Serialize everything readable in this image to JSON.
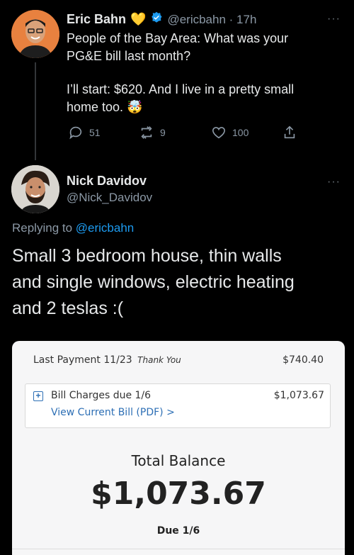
{
  "tweet": {
    "name": "Eric Bahn",
    "emoji_heart": "💛",
    "handle_time": "@ericbahn · 17h",
    "text_line1": "People of the Bay Area: What was your",
    "text_line2": "PG&E bill last month?",
    "text_line3": "I’ll start: $620. And I live in a pretty small",
    "text_line4": "home too.",
    "text_emoji": "🤯",
    "replies": "51",
    "retweets": "9",
    "likes": "100",
    "more": "···"
  },
  "reply": {
    "name": "Nick Davidov",
    "handle": "@Nick_Davidov",
    "replying_prefix": "Replying to ",
    "replying_to": "@ericbahn",
    "line1": "Small 3 bedroom house, thin walls",
    "line2": "and single windows, electric heating",
    "line3": "and 2 teslas :(",
    "more": "···"
  },
  "bill_card": {
    "last_payment_label": "Last Payment 11/23",
    "thank_you": "Thank You",
    "last_payment_amount": "$740.40",
    "plus_symbol": "+",
    "bill_charges_label": "Bill Charges due 1/6",
    "bill_charges_amount": "$1,073.67",
    "view_bill_link": "View Current Bill (PDF) >",
    "total_label": "Total Balance",
    "total_amount": "$1,073.67",
    "due_label": "Due 1/6"
  },
  "colors": {
    "background": "#000000",
    "link_blue": "#1d9bf0",
    "verified": "#1d9bf0",
    "card_link": "#2d6fb5"
  }
}
